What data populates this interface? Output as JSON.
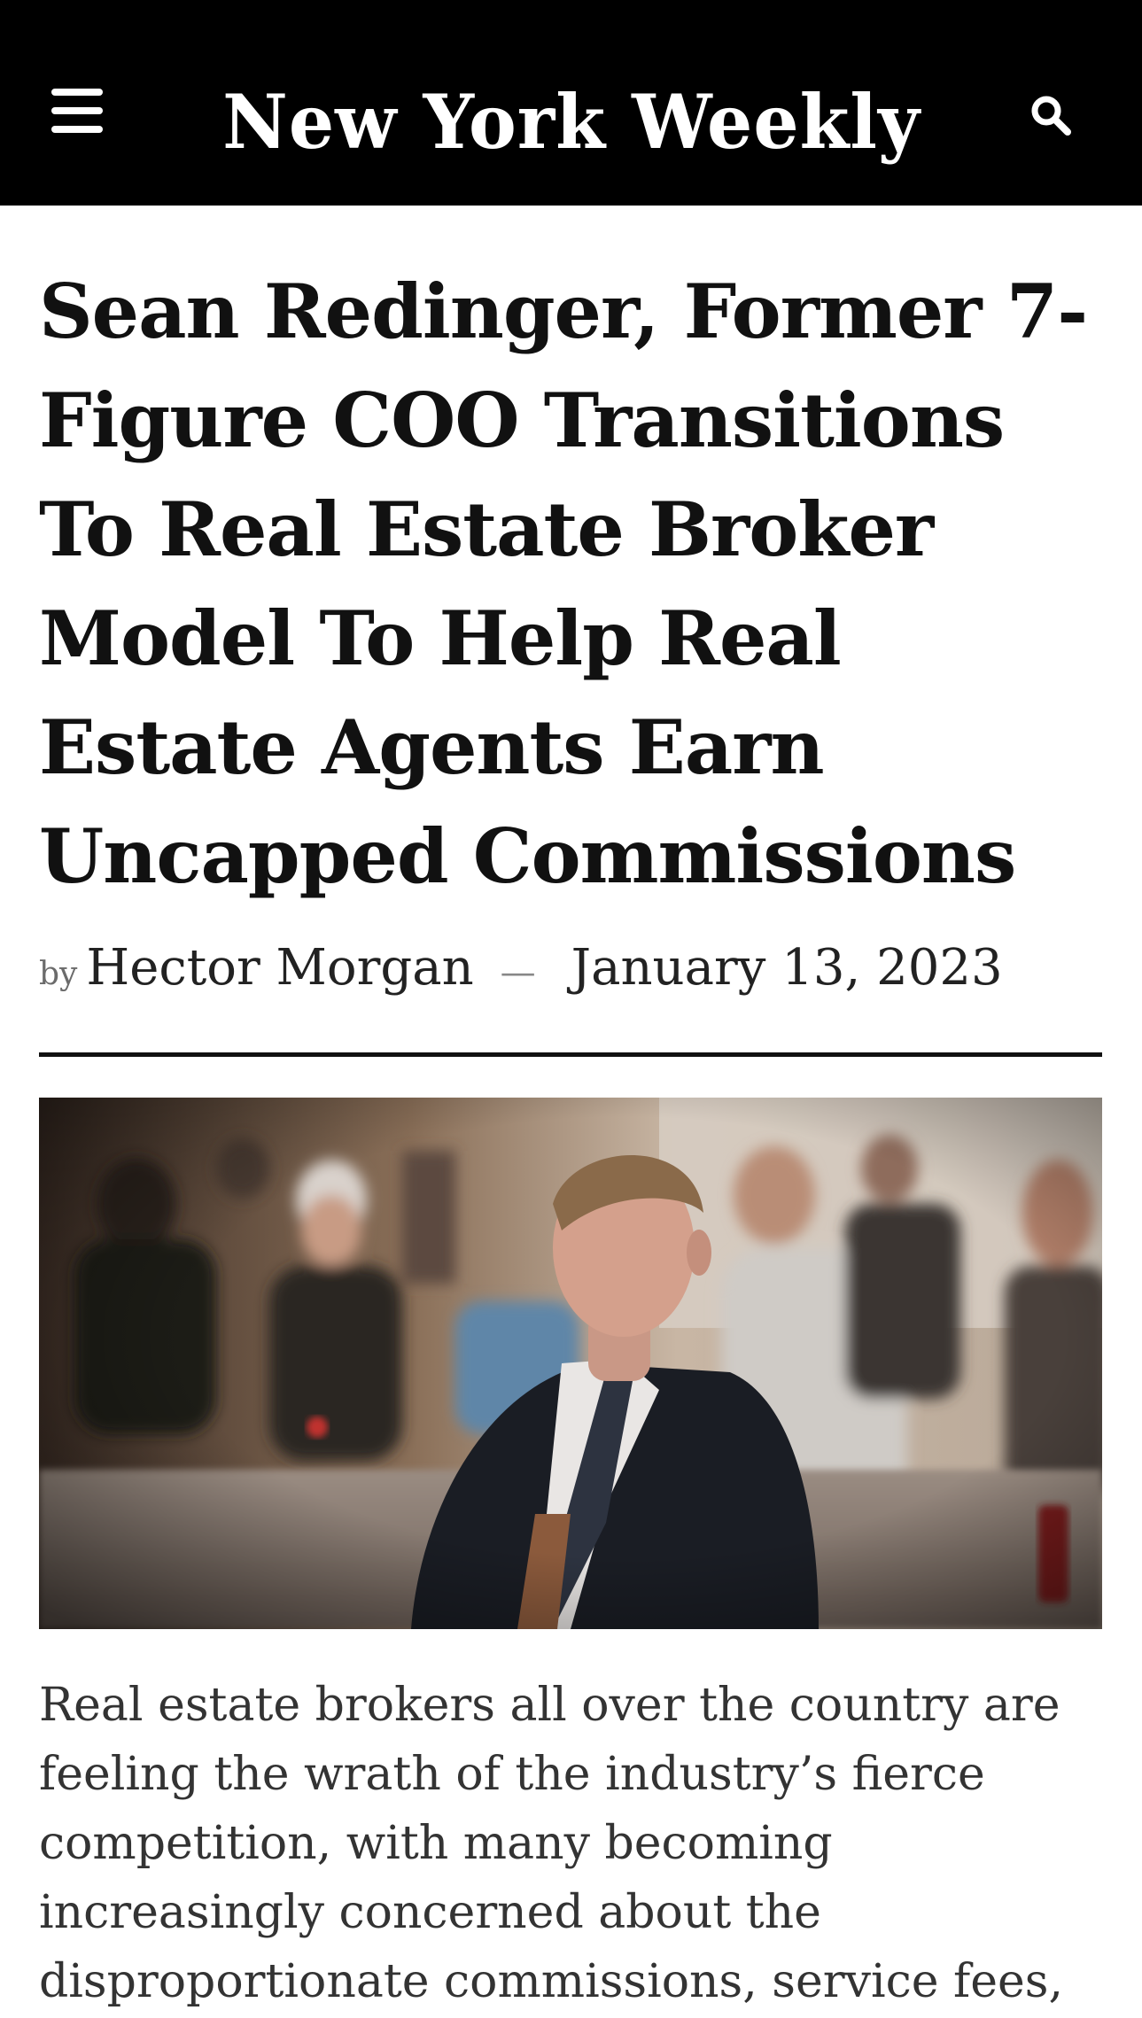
{
  "header": {
    "logo_text": "New York Weekly",
    "menu_icon": "hamburger-menu-icon",
    "search_icon": "search-icon",
    "background": "#000000"
  },
  "article": {
    "headline": "Sean Redinger, Former 7-Figure COO Transitions To Real Estate Broker Model To Help Real Estate Agents Earn Uncapped Commissions",
    "by": "by",
    "author": "Hector Morgan",
    "dash": "—",
    "date": "January 13, 2023",
    "body": "Real estate brokers all over the country are feeling the wrath of the industry’s fierce competition, with many becoming increasingly concerned about the disproportionate commissions, service fees,"
  }
}
